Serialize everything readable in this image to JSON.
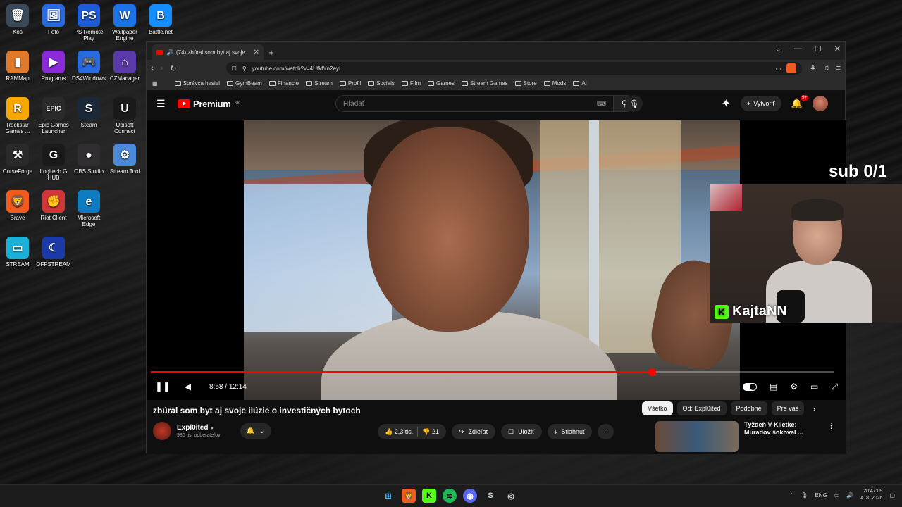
{
  "desktop": {
    "icons": [
      {
        "label": "Kôš",
        "symbol": "🗑",
        "color": "#3a4a5a"
      },
      {
        "label": "Foto",
        "symbol": "🖼",
        "color": "#2a6adf"
      },
      {
        "label": "PS Remote Play",
        "symbol": "PS",
        "color": "#1e5bd8"
      },
      {
        "label": "Wallpaper Engine",
        "symbol": "W",
        "color": "#1a73e8"
      },
      {
        "label": "Battle.net",
        "symbol": "B",
        "color": "#148eff"
      },
      {
        "label": "RAMMap",
        "symbol": "▮",
        "color": "#e07a2a"
      },
      {
        "label": "Programs",
        "symbol": "▶",
        "color": "#8a2ad8"
      },
      {
        "label": "DS4Windows",
        "symbol": "🎮",
        "color": "#2a6adf"
      },
      {
        "label": "CZManager",
        "symbol": "⌂",
        "color": "#5a3aa8"
      },
      {
        "label": "Rockstar Games ...",
        "symbol": "R",
        "color": "#f5a800"
      },
      {
        "label": "Epic Games Launcher",
        "symbol": "EPIC",
        "color": "#2a2a2a"
      },
      {
        "label": "Steam",
        "symbol": "S",
        "color": "#1b2838"
      },
      {
        "label": "Ubisoft Connect",
        "symbol": "U",
        "color": "#1a1a1a"
      },
      {
        "label": "CurseForge",
        "symbol": "⚒",
        "color": "#2a2a2a"
      },
      {
        "label": "Logitech G HUB",
        "symbol": "G",
        "color": "#1a1a1a"
      },
      {
        "label": "OBS Studio",
        "symbol": "●",
        "color": "#302e31"
      },
      {
        "label": "Stream Tool",
        "symbol": "⚙",
        "color": "#4a8ad8"
      },
      {
        "label": "Brave",
        "symbol": "🦁",
        "color": "#f25a1e"
      },
      {
        "label": "Riot Client",
        "symbol": "✊",
        "color": "#d13639"
      },
      {
        "label": "Microsoft Edge",
        "symbol": "e",
        "color": "#0f7cc2"
      },
      {
        "label": "STREAM",
        "symbol": "▭",
        "color": "#1ab0d8"
      },
      {
        "label": "OFFSTREAM",
        "symbol": "☾",
        "color": "#1a3aa8"
      }
    ]
  },
  "browser": {
    "tab_title": "(74) zbúral som byt aj svoje",
    "url": "youtube.com/watch?v=4UfkfYn2eyI",
    "bookmarks": [
      "Správca hesiel",
      "GymBeam",
      "Financie",
      "Stream",
      "Profil",
      "Socials",
      "Film",
      "Games",
      "Stream Games",
      "Store",
      "Mods",
      "AI"
    ]
  },
  "youtube": {
    "logo_text": "Premium",
    "region": "SK",
    "search_placeholder": "Hľadať",
    "create_label": "Vytvoriť",
    "notif_badge": "9+",
    "time_display": "8:58 / 12:14",
    "progress_fraction": 0.733,
    "video_title": "zbúral som byt aj svoje ilúzie o investičných bytoch",
    "channel_name": "Expl0ited",
    "channel_subs": "980 tis. odberateľov",
    "likes": "2,3 tis.",
    "dislikes": "21",
    "share_label": "Zdieľať",
    "save_label": "Uložiť",
    "download_label": "Stiahnuť",
    "chips": [
      "Všetko",
      "Od: Expl0ited",
      "Podobné",
      "Pre vás"
    ],
    "rec_title": "Týždeň V Klietke: Muradov šokoval ..."
  },
  "overlay": {
    "sub_text": "sub 0/1",
    "streamer_name": "KajtaNN"
  },
  "taskbar": {
    "lang": "ENG",
    "time": "20:47:09",
    "date": "4. 8. 2026"
  }
}
